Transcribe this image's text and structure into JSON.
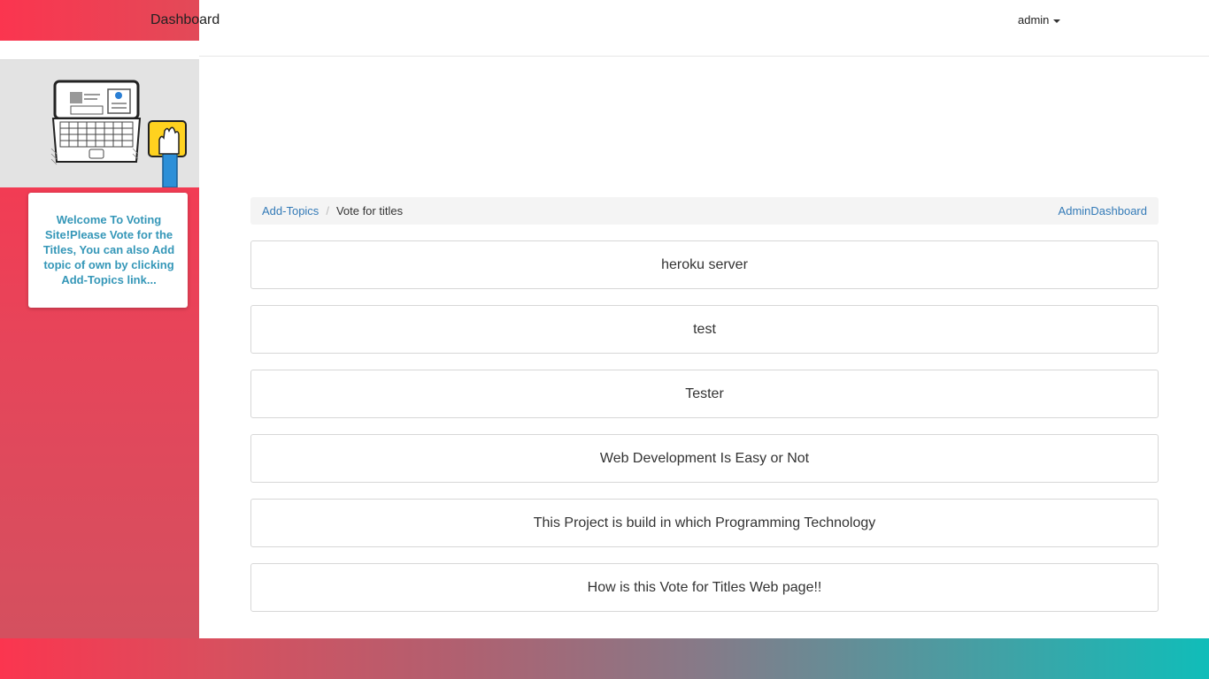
{
  "header": {
    "brand": "Dashboard",
    "user": "admin"
  },
  "sidebar": {
    "welcome_text": "Welcome To Voting Site!Please Vote for the Titles, You can also Add topic of own by clicking Add-Topics link..."
  },
  "breadcrumb": {
    "link": "Add-Topics",
    "current": "Vote for titles",
    "right_link": "AdminDashboard"
  },
  "topics": [
    "heroku server",
    "test",
    "Tester",
    "Web Development Is Easy or Not",
    "This Project is build in which Programming Technology",
    "How is this Vote for Titles Web page!!"
  ],
  "colors": {
    "accent_red": "#fb354f",
    "accent_teal": "#10bdb9",
    "link_blue": "#337ab7",
    "welcome_text": "#3597b8"
  }
}
